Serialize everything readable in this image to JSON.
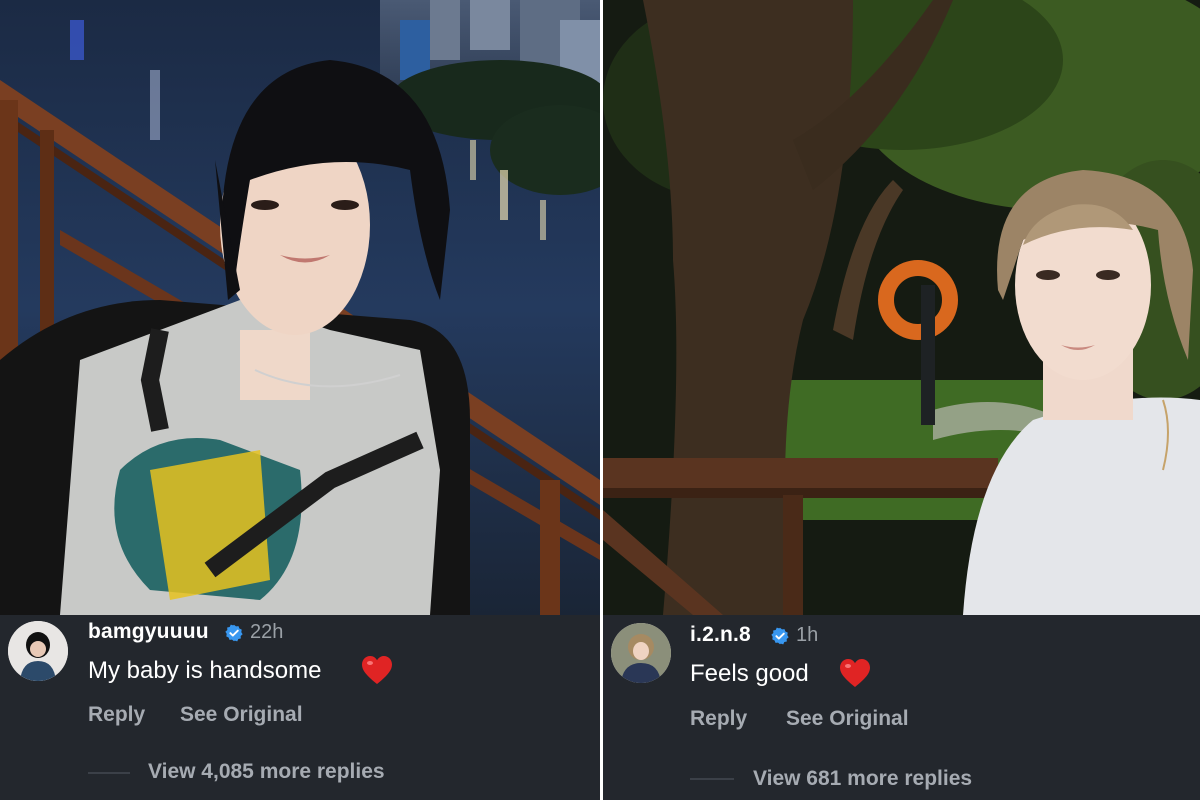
{
  "comments": [
    {
      "username": "bamgyuuuu",
      "time": "22h",
      "text": "My baby is handsome",
      "reply_label": "Reply",
      "see_original_label": "See Original",
      "more_replies_label": "View 4,085 more replies"
    },
    {
      "username": "i.2.n.8",
      "time": "1h",
      "text": "Feels good",
      "reply_label": "Reply",
      "see_original_label": "See Original",
      "more_replies_label": "View 681 more replies"
    }
  ],
  "icons": {
    "verified": "verified-badge-icon",
    "heart": "red-heart-emoji"
  },
  "colors": {
    "background": "#23272d",
    "verified": "#3897f0",
    "heart": "#e02424",
    "secondary_text": "#a6abb2"
  }
}
